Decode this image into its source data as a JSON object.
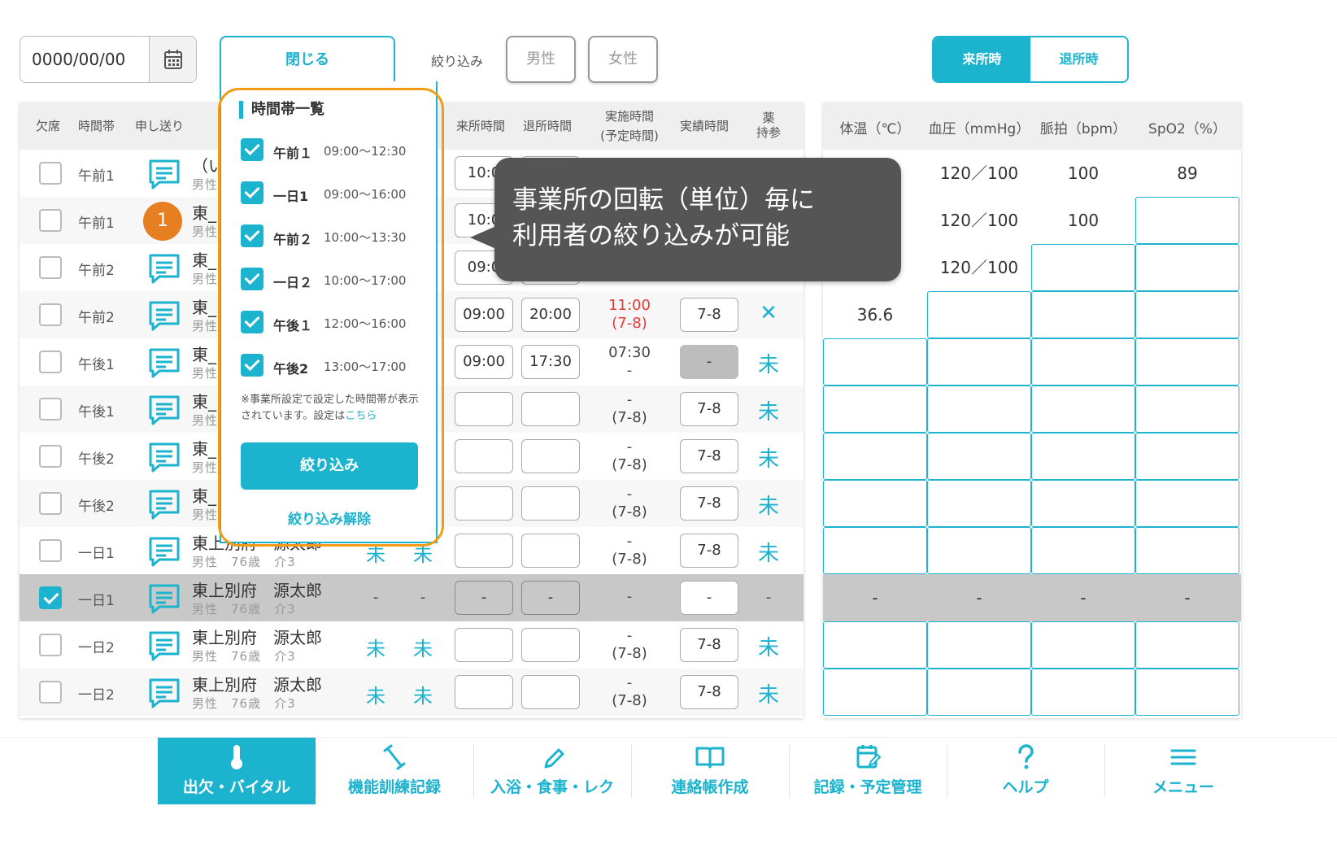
{
  "toolbar": {
    "date_value": "0000/00/00",
    "close_label": "閉じる",
    "filter_label": "絞り込み",
    "male_label": "男性",
    "female_label": "女性",
    "arrival_label": "来所時",
    "departure_label": "退所時"
  },
  "left_table": {
    "headers": {
      "absent": "欠席",
      "timezone": "時間帯",
      "handover": "申し送り",
      "arrival_time": "来所時間",
      "departure_time": "退所時間",
      "actual_time_1": "実施時間",
      "actual_time_2": "(予定時間)",
      "result_time": "実績時間",
      "medicine_1": "薬",
      "medicine_2": "持参"
    },
    "rows": [
      {
        "tz": "午前1",
        "name": "（い",
        "sub": "男性",
        "arr": "10:0",
        "dep": "",
        "jt1": "",
        "jt2": "",
        "rb": "",
        "med": ""
      },
      {
        "tz": "午前1",
        "name": "東_",
        "sub": "男性",
        "arr": "10:0",
        "dep": "",
        "jt1": "",
        "jt2": "",
        "rb": "",
        "med": ""
      },
      {
        "tz": "午前2",
        "name": "東_",
        "sub": "男性",
        "arr": "09:0",
        "dep": "",
        "jt1": "",
        "jt2": "",
        "rb": "",
        "med": ""
      },
      {
        "tz": "午前2",
        "name": "東_",
        "sub": "男性",
        "arr": "09:00",
        "dep": "20:00",
        "jt1": "11:00",
        "jt2": "(7-8)",
        "rb": "7-8",
        "med": "✕"
      },
      {
        "tz": "午後1",
        "name": "東_",
        "sub": "男性",
        "arr": "09:00",
        "dep": "17:30",
        "jt1": "07:30",
        "jt2": "-",
        "rb": "-",
        "med": "未"
      },
      {
        "tz": "午後1",
        "name": "東_",
        "sub": "男性",
        "arr": "",
        "dep": "",
        "jt1": "-",
        "jt2": "(7-8)",
        "rb": "7-8",
        "med": "未"
      },
      {
        "tz": "午後2",
        "name": "東_",
        "sub": "男性",
        "arr": "",
        "dep": "",
        "jt1": "-",
        "jt2": "(7-8)",
        "rb": "7-8",
        "med": "未"
      },
      {
        "tz": "午後2",
        "name": "東_",
        "sub": "男性",
        "arr": "",
        "dep": "",
        "jt1": "-",
        "jt2": "(7-8)",
        "rb": "7-8",
        "med": "未"
      },
      {
        "tz": "一日1",
        "name": "東上別府　源太郎",
        "sub": "男性　76歳　介3",
        "m1": "未",
        "m2": "未",
        "arr": "",
        "dep": "",
        "jt1": "-",
        "jt2": "(7-8)",
        "rb": "7-8",
        "med": "未"
      },
      {
        "tz": "一日1",
        "name": "東上別府　源太郎",
        "sub": "男性　76歳　介3",
        "m1": "-",
        "m2": "-",
        "arr": "-",
        "dep": "-",
        "jt1": "-",
        "jt2": "",
        "rb": "-",
        "med": "-"
      },
      {
        "tz": "一日2",
        "name": "東上別府　源太郎",
        "sub": "男性　76歳　介3",
        "m1": "未",
        "m2": "未",
        "arr": "",
        "dep": "",
        "jt1": "-",
        "jt2": "(7-8)",
        "rb": "7-8",
        "med": "未"
      },
      {
        "tz": "一日2",
        "name": "東上別府　源太郎",
        "sub": "男性　76歳　介3",
        "m1": "未",
        "m2": "未",
        "arr": "",
        "dep": "",
        "jt1": "-",
        "jt2": "(7-8)",
        "rb": "7-8",
        "med": "未"
      }
    ],
    "badge": "1"
  },
  "vitals": {
    "headers": {
      "temp": "体温（℃）",
      "bp": "血圧（mmHg）",
      "pulse": "脈拍（bpm）",
      "spo2": "SpO2（%）"
    },
    "rows": [
      [
        "",
        "120／100",
        "100",
        "89"
      ],
      [
        "",
        "120／100",
        "100",
        ""
      ],
      [
        "",
        "120／100",
        "",
        ""
      ],
      [
        "36.6",
        "",
        "",
        ""
      ],
      [
        "",
        "",
        "",
        ""
      ],
      [
        "",
        "",
        "",
        ""
      ],
      [
        "",
        "",
        "",
        ""
      ],
      [
        "",
        "",
        "",
        ""
      ],
      [
        "",
        "",
        "",
        ""
      ],
      [
        "-",
        "-",
        "-",
        "-"
      ],
      [
        "",
        "",
        "",
        ""
      ],
      [
        "",
        "",
        "",
        ""
      ]
    ]
  },
  "dropdown": {
    "title": "時間帯一覧",
    "options": [
      {
        "name": "午前１",
        "time": "09:00〜12:30"
      },
      {
        "name": "一日1",
        "time": "09:00〜16:00"
      },
      {
        "name": "午前２",
        "time": "10:00〜13:30"
      },
      {
        "name": "一日２",
        "time": "10:00〜17:00"
      },
      {
        "name": "午後１",
        "time": "12:00〜16:00"
      },
      {
        "name": "午後2",
        "time": "13:00〜17:00"
      }
    ],
    "note": "※事業所設定で設定した時間帯が表示されています。設定は",
    "note_link": "こちら",
    "apply_label": "絞り込み",
    "clear_label": "絞り込み解除"
  },
  "tooltip": {
    "line1": "事業所の回転（単位）毎に",
    "line2": "利用者の絞り込みが可能"
  },
  "nav": [
    {
      "label": "出欠・バイタル",
      "icon": "thermometer-icon"
    },
    {
      "label": "機能訓練記録",
      "icon": "dumbbell-icon"
    },
    {
      "label": "入浴・食事・レク",
      "icon": "pencil-icon"
    },
    {
      "label": "連絡帳作成",
      "icon": "book-icon"
    },
    {
      "label": "記録・予定管理",
      "icon": "calendar-edit-icon"
    },
    {
      "label": "ヘルプ",
      "icon": "help-icon"
    },
    {
      "label": "メニュー",
      "icon": "menu-icon"
    }
  ],
  "colors": {
    "accent": "#1cb3cf",
    "highlight": "#f39c12",
    "badge": "#e67e22",
    "tooltip": "#555555"
  }
}
